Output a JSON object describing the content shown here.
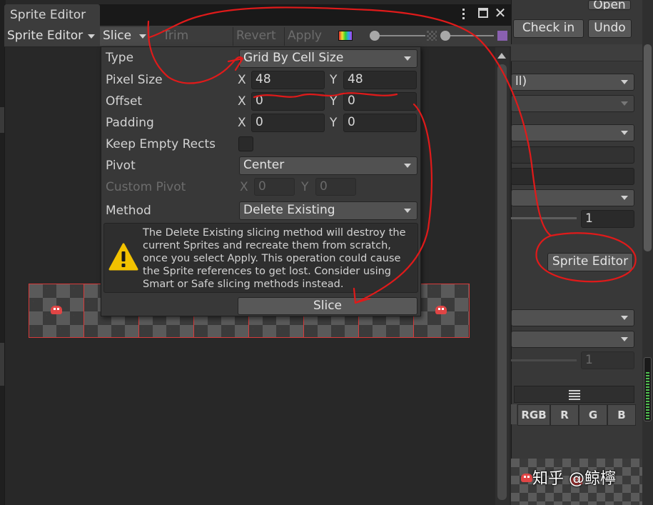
{
  "window": {
    "title": "Sprite Editor",
    "more_icon": "kebab-menu-icon",
    "maximize_icon": "maximize-icon",
    "close_icon": "close-icon"
  },
  "toolbar": {
    "mode_dropdown": "Sprite Editor",
    "slice": "Slice",
    "trim": "Trim",
    "revert": "Revert",
    "apply": "Apply"
  },
  "slice_popup": {
    "type_label": "Type",
    "type_value": "Grid By Cell Size",
    "pixel_size_label": "Pixel Size",
    "pixel_size_x": "48",
    "pixel_size_y": "48",
    "offset_label": "Offset",
    "offset_x": "0",
    "offset_y": "0",
    "padding_label": "Padding",
    "padding_x": "0",
    "padding_y": "0",
    "x_label": "X",
    "y_label": "Y",
    "keep_empty_label": "Keep Empty Rects",
    "pivot_label": "Pivot",
    "pivot_value": "Center",
    "custom_pivot_label": "Custom Pivot",
    "custom_pivot_x": "0",
    "custom_pivot_y": "0",
    "method_label": "Method",
    "method_value": "Delete Existing",
    "warning_text": "The Delete Existing slicing method will destroy the current Sprites and recreate them from scratch, once you select Apply. This operation could cause the Sprite references to get lost. Consider using Smart or Safe slicing methods instead.",
    "slice_button": "Slice"
  },
  "inspector": {
    "open_button": "Open",
    "check_in_button": "Check in",
    "undo_button": "Undo",
    "dropdown_partial": "ll)",
    "field_value_1": "1",
    "sprite_editor_button": "Sprite Editor",
    "field_value_2": "1",
    "channels": [
      "RGB",
      "R",
      "G",
      "B"
    ]
  },
  "watermark": "知乎 @鲸檸",
  "colors": {
    "annotation_red": "#e01a1a",
    "slice_outline": "#d83a3a",
    "warning_yellow": "#f2c200"
  }
}
